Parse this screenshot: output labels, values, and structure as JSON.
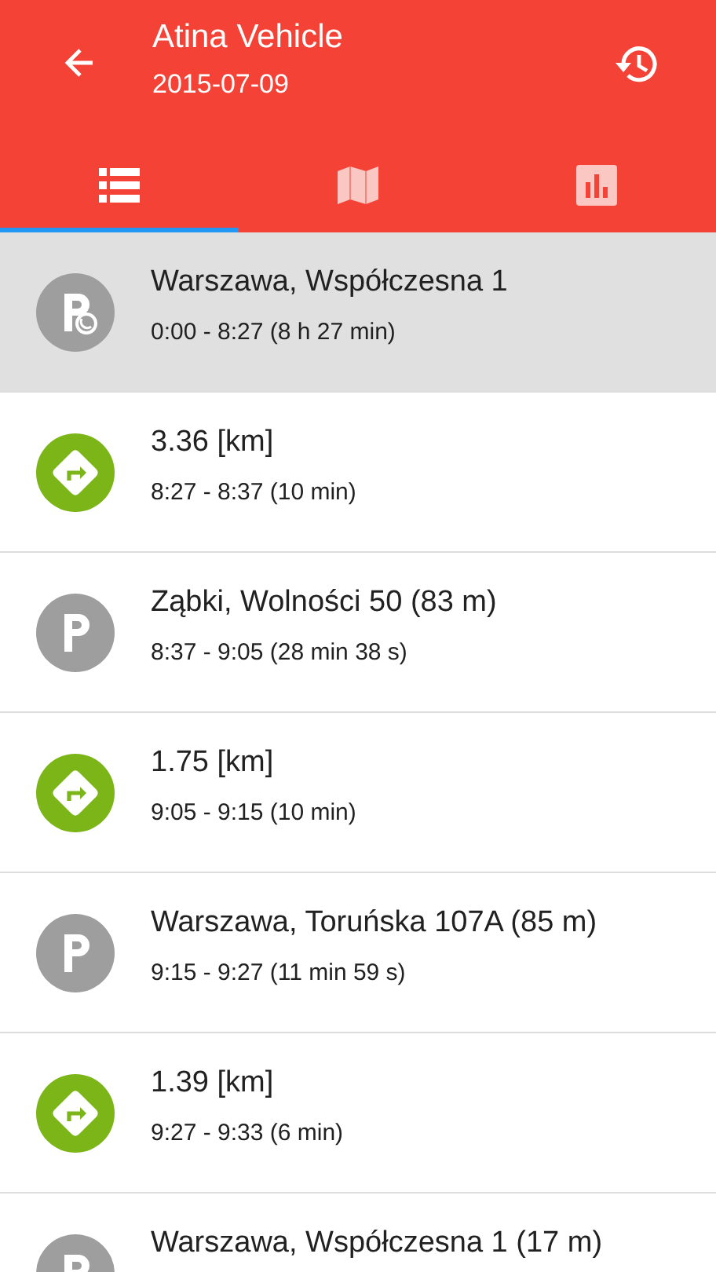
{
  "app_bar": {
    "title": "Atina Vehicle",
    "subtitle": "2015-07-09"
  },
  "tabs": [
    {
      "kind": "list",
      "selected": true
    },
    {
      "kind": "map",
      "selected": false
    },
    {
      "kind": "chart",
      "selected": false
    }
  ],
  "entries": [
    {
      "kind": "parking_current",
      "title": "Warszawa, Współczesna 1",
      "time": "0:00 - 8:27 (8 h 27 min)",
      "selected": true
    },
    {
      "kind": "drive",
      "title": "3.36 [km]",
      "time": "8:27 - 8:37 (10 min)",
      "selected": false
    },
    {
      "kind": "parking",
      "title": "Ząbki, Wolności 50 (83 m)",
      "time": "8:37 - 9:05 (28 min 38 s)",
      "selected": false
    },
    {
      "kind": "drive",
      "title": "1.75 [km]",
      "time": "9:05 - 9:15 (10 min)",
      "selected": false
    },
    {
      "kind": "parking",
      "title": "Warszawa, Toruńska 107A (85 m)",
      "time": "9:15 - 9:27 (11 min 59 s)",
      "selected": false
    },
    {
      "kind": "drive",
      "title": "1.39 [km]",
      "time": "9:27 - 9:33 (6 min)",
      "selected": false
    },
    {
      "kind": "parking",
      "title": "Warszawa, Współczesna 1 (17 m)",
      "selected": false
    }
  ]
}
